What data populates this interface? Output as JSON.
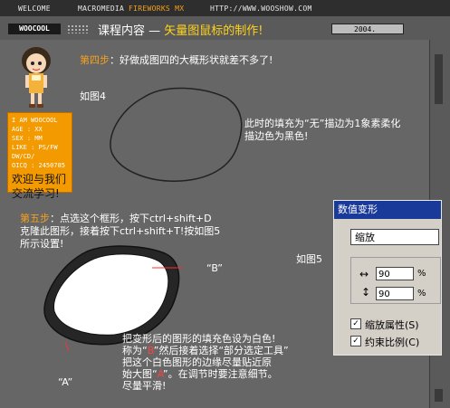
{
  "topbar": {
    "welcome": "WELCOME",
    "brand": "MACROMEDIA",
    "brand_accent": "FIREWORKS MX",
    "url": "HTTP://WWW.WOOSHOW.COM"
  },
  "header": {
    "logo": "WOOCOOL",
    "course_label": "课程内容 —",
    "course_title": "矢量图鼠标的制作!",
    "year": "2004."
  },
  "profile": {
    "lines": [
      "I AM WOOCOOL",
      "AGE : XX",
      "SEX : MM",
      "LIKE : PS/FW",
      "DW/CD/",
      "OICQ : 2450785"
    ],
    "welcome": "欢迎与我们",
    "welcome2": "交流学习!"
  },
  "step4": {
    "label": "第四步",
    "text": "：好做成图四的大概形状就差不多了!"
  },
  "fig4": "如图4",
  "fill_note": {
    "line1": "此时的填充为“无”描边为1象素柔化",
    "line2": "描边色为黑色!"
  },
  "step5": {
    "label": "第五步",
    "line1": "：点选这个框形，按下ctrl+shift+D",
    "line2": "克隆此图形，接着按下ctrl+shift+T!按如图5",
    "line3": "所示设置!"
  },
  "fig5": "如图5",
  "label_b": "“B”",
  "label_a": "“A”",
  "bottom_note": {
    "line1": "把变形后的图形的填充色设为白色!",
    "line2a": "称为“",
    "b": "B",
    "line2b": "”然后接着选择“部分选定工具”",
    "line3": "把这个白色图形的边缘尽量贴近原",
    "line4a": "始大图“",
    "a": "A",
    "line4b": "”。在调节时要注意细节。",
    "line5": "尽量平滑!"
  },
  "numeric_transform": {
    "title": "数值变形",
    "mode": "缩放",
    "width": "90",
    "height": "90",
    "unit": "%",
    "scale_attributes": "缩放属性(S)",
    "constrain": "约束比例(C)",
    "scale_checked": true,
    "constrain_checked": true
  }
}
